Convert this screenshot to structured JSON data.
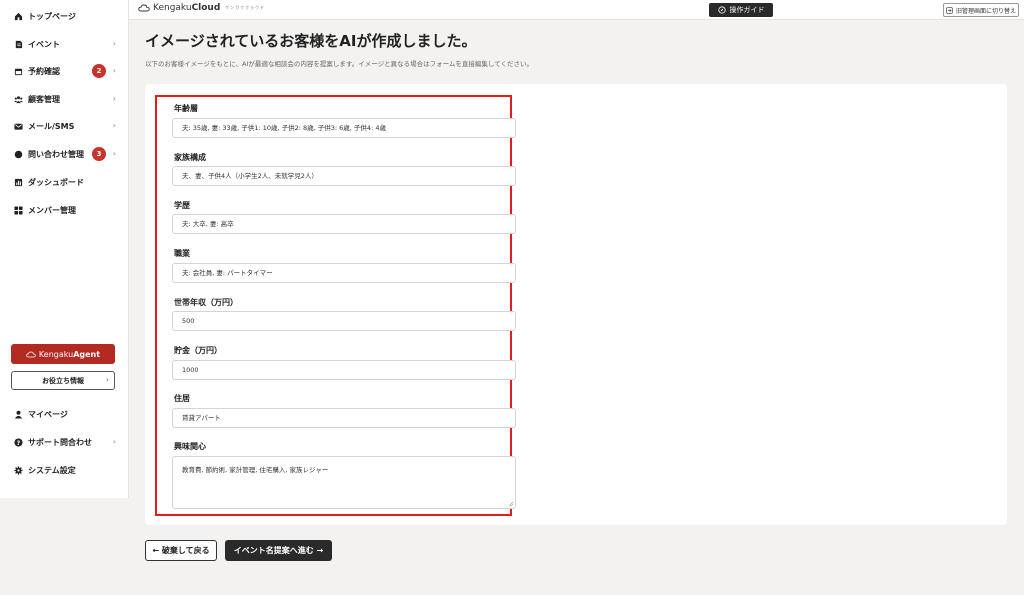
{
  "sidebar": {
    "items": [
      {
        "label": "トップページ",
        "icon": "home-icon",
        "chevron": "",
        "badge": ""
      },
      {
        "label": "イベント",
        "icon": "document-icon",
        "chevron": "›",
        "badge": ""
      },
      {
        "label": "予約確認",
        "icon": "calendar-icon",
        "chevron": "›",
        "badge": "2"
      },
      {
        "label": "顧客管理",
        "icon": "users-icon",
        "chevron": "›",
        "badge": ""
      },
      {
        "label": "メール/SMS",
        "icon": "mail-icon",
        "chevron": "›",
        "badge": ""
      },
      {
        "label": "問い合わせ管理",
        "icon": "chat-icon",
        "chevron": "›",
        "badge": "3"
      },
      {
        "label": "ダッシュボード",
        "icon": "chart-icon",
        "chevron": "",
        "badge": ""
      },
      {
        "label": "メンバー管理",
        "icon": "grid-icon",
        "chevron": "",
        "badge": ""
      }
    ],
    "agent_button": {
      "brand_light": "Kengaku",
      "brand_bold": "Agent"
    },
    "info_button": {
      "label": "お役立ち情報",
      "chevron": "›"
    },
    "bottom_items": [
      {
        "label": "マイページ",
        "icon": "person-icon",
        "chevron": ""
      },
      {
        "label": "サポート問合わせ",
        "icon": "help-icon",
        "chevron": "›"
      },
      {
        "label": "システム設定",
        "icon": "gear-icon",
        "chevron": ""
      }
    ]
  },
  "header": {
    "logo_light": "Kengaku",
    "logo_bold": "Cloud",
    "logo_sub": "ケンガククラウド",
    "guide_label": "操作ガイド",
    "old_admin_label": "旧管理画面に切り替え"
  },
  "main": {
    "title": "イメージされているお客様をAIが作成しました。",
    "subtitle": "以下のお客様イメージをもとに、AIが最適な相談会の内容を提案します。イメージと異なる場合はフォームを直接編集してください。",
    "fields": [
      {
        "label": "年齢層",
        "value": "夫: 35歳, 妻: 33歳, 子供1: 10歳, 子供2: 8歳, 子供3: 6歳, 子供4: 4歳"
      },
      {
        "label": "家族構成",
        "value": "夫、妻、子供4人（小学生2人、未就学児2人）"
      },
      {
        "label": "学歴",
        "value": "夫: 大卒, 妻: 高卒"
      },
      {
        "label": "職業",
        "value": "夫: 会社員, 妻: パートタイマー"
      },
      {
        "label": "世帯年収（万円）",
        "value": "500"
      },
      {
        "label": "貯金（万円）",
        "value": "1000"
      },
      {
        "label": "住居",
        "value": "賃貸アパート"
      },
      {
        "label": "興味関心",
        "value": "教育費, 節約術, 家計管理, 住宅購入, 家族レジャー"
      }
    ],
    "back_button": "← 破棄して戻る",
    "next_button": "イベント名提案へ進む →"
  },
  "colors": {
    "accent": "#b32a22",
    "badge": "#c8342c",
    "highlight_border": "#e01e1e",
    "dark_button": "#2a2a2a"
  }
}
